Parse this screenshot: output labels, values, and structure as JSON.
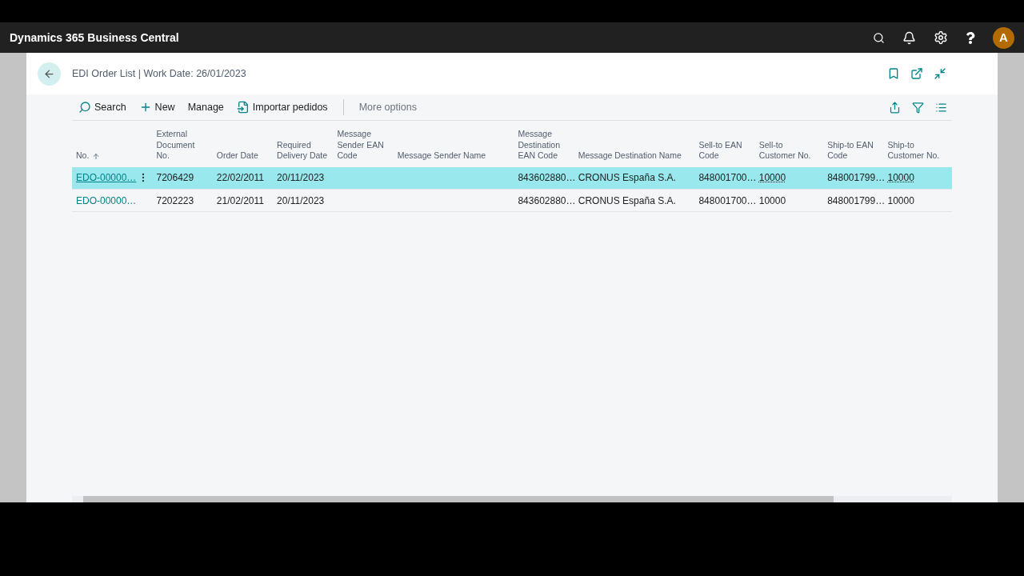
{
  "app_bar": {
    "title": "Dynamics 365 Business Central",
    "avatar": "A"
  },
  "page": {
    "title": "EDI Order List | Work Date: 26/01/2023"
  },
  "actions": [
    {
      "label": "Search",
      "kind": "search"
    },
    {
      "label": "New",
      "kind": "new"
    },
    {
      "label": "Manage",
      "kind": "plain"
    },
    {
      "label": "Importar pedidos",
      "kind": "import"
    },
    {
      "label": "More options",
      "kind": "more"
    }
  ],
  "table": {
    "columns": [
      {
        "label": "No.",
        "kind": "link",
        "sorted": true
      },
      {
        "label": "External Document No.",
        "kind": "text",
        "sorted": false
      },
      {
        "label": "Order Date",
        "kind": "text",
        "sorted": false
      },
      {
        "label": "Required Delivery Date",
        "kind": "text",
        "sorted": false
      },
      {
        "label": "Message Sender EAN Code",
        "kind": "text",
        "sorted": false
      },
      {
        "label": "Message Sender Name",
        "kind": "text",
        "sorted": false
      },
      {
        "label": "Message Destination EAN Code",
        "kind": "text",
        "sorted": false
      },
      {
        "label": "Message Destination Name",
        "kind": "text",
        "sorted": false
      },
      {
        "label": "Sell-to EAN Code",
        "kind": "text",
        "sorted": false
      },
      {
        "label": "Sell-to Customer No.",
        "kind": "lookup",
        "sorted": false
      },
      {
        "label": "Ship-to EAN Code",
        "kind": "text",
        "sorted": false
      },
      {
        "label": "Ship-to Customer No.",
        "kind": "lookup",
        "sorted": false
      }
    ],
    "rows": [
      {
        "selected": true,
        "cells": [
          "EDO-00000…",
          "7206429",
          "22/02/2011",
          "20/11/2023",
          "",
          "",
          "843602880…",
          "CRONUS España S.A.",
          "848001700…",
          "10000",
          "848001799…",
          "10000"
        ]
      },
      {
        "selected": false,
        "cells": [
          "EDO-00000…",
          "7202223",
          "21/02/2011",
          "20/11/2023",
          "",
          "",
          "843602880…",
          "CRONUS España S.A.",
          "848001700…",
          "10000",
          "848001799…",
          "10000"
        ]
      }
    ]
  }
}
